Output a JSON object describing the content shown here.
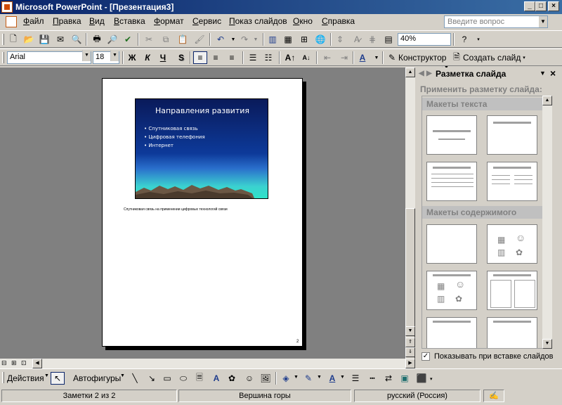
{
  "window": {
    "title": "Microsoft PowerPoint - [Презентация3]",
    "min": "_",
    "max": "□",
    "close": "×"
  },
  "menu": [
    "Файл",
    "Правка",
    "Вид",
    "Вставка",
    "Формат",
    "Сервис",
    "Показ слайдов",
    "Окно",
    "Справка"
  ],
  "ask": {
    "placeholder": "Введите вопрос"
  },
  "standard_toolbar": {
    "zoom": "40%"
  },
  "format_toolbar": {
    "font": "Arial",
    "size": "18",
    "bold": "Ж",
    "italic": "К",
    "underline": "Ч",
    "shadow": "S",
    "designer": "Конструктор",
    "new_slide": "Создать слайд"
  },
  "slide": {
    "title": "Направления развития",
    "bullets": [
      "Спутниковая связь",
      "Цифровая телефония",
      "Интернет"
    ]
  },
  "notes": {
    "text": "Спутниковая связь на применении цифровых технологий связи"
  },
  "page_number": "2",
  "taskpane": {
    "title": "Разметка слайда",
    "apply_label": "Применить разметку слайда:",
    "section_text": "Макеты текста",
    "section_content": "Макеты содержимого",
    "show_on_insert": "Показывать при вставке слайдов"
  },
  "drawing": {
    "actions": "Действия",
    "autoshapes": "Автофигуры"
  },
  "status": {
    "notes": "Заметки 2 из 2",
    "design": "Вершина горы",
    "language": "русский (Россия)"
  }
}
